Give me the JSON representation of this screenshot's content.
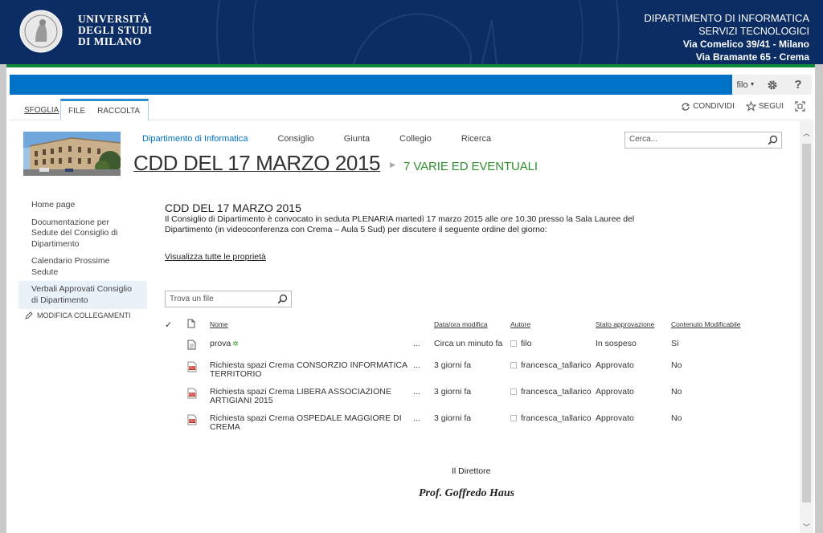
{
  "banner": {
    "university": [
      "UNIVERSITÀ",
      "DEGLI STUDI",
      "DI MILANO"
    ],
    "department": "DIPARTIMENTO DI INFORMATICA",
    "service": "SERVIZI TECNOLOGICI",
    "address_1": "Via Comelico 39/41 - Milano",
    "address_2": "Via Bramante 65 - Crema"
  },
  "suitebar": {
    "user": "filo",
    "icons": [
      "gear-icon",
      "help-icon"
    ],
    "help_label": "?"
  },
  "ribbon": {
    "tabs": [
      "SFOGLIA",
      "FILE",
      "RACCOLTA"
    ],
    "actions": [
      {
        "icon": "sync-icon",
        "label": "CONDIVIDI"
      },
      {
        "icon": "star-icon",
        "label": "SEGUI"
      },
      {
        "icon": "focus-icon",
        "label": ""
      }
    ]
  },
  "topnav": {
    "items": [
      "Dipartimento di Informatica",
      "Consiglio",
      "Giunta",
      "Collegio",
      "Ricerca"
    ],
    "selected": 0
  },
  "search": {
    "placeholder": "Cerca..."
  },
  "header": {
    "title": "CDD DEL 17 MARZO 2015",
    "subtitle": "7 VARIE ED EVENTUALI"
  },
  "quicklaunch": {
    "items": [
      "Home page",
      "Documentazione per Sedute del Consiglio di Dipartimento",
      "Calendario Prossime Sedute",
      "Verbali Approvati Consiglio di Dipartimento"
    ],
    "selected": 3,
    "edit_links": "MODIFICA COLLEGAMENTI"
  },
  "content": {
    "title": "CDD DEL 17 MARZO 2015",
    "description": "Il Consiglio di Dipartimento è convocato in seduta PLENARIA martedì 17 marzo 2015 alle ore 10.30 presso la Sala Lauree del Dipartimento (in videoconferenza con Crema – Aula 5 Sud) per discutere il seguente ordine del giorno:",
    "properties_link": "Visualizza tutte le proprietà",
    "find_placeholder": "Trova un file"
  },
  "table": {
    "columns": [
      "Nome",
      "Data/ora modifica",
      "Autore",
      "Stato approvazione",
      "Contenuto Modificabile"
    ],
    "rows": [
      {
        "icon": "document-icon",
        "name": "prova",
        "is_new": true,
        "modified": "Circa un minuto fa",
        "author": "filo",
        "status": "In sospeso",
        "editable": "Sì"
      },
      {
        "icon": "pdf-icon",
        "name": "Richiesta spazi Crema CONSORZIO INFORMATICA TERRITORIO",
        "is_new": false,
        "modified": "3 giorni fa",
        "author": "francesca_tallarico",
        "status": "Approvato",
        "editable": "No"
      },
      {
        "icon": "pdf-icon",
        "name": "Richiesta spazi Crema LIBERA ASSOCIAZIONE ARTIGIANI 2015",
        "is_new": false,
        "modified": "3 giorni fa",
        "author": "francesca_tallarico",
        "status": "Approvato",
        "editable": "No"
      },
      {
        "icon": "pdf-icon",
        "name": "Richiesta spazi Crema OSPEDALE MAGGIORE DI CREMA",
        "is_new": false,
        "modified": "3 giorni fa",
        "author": "francesca_tallarico",
        "status": "Approvato",
        "editable": "No"
      }
    ],
    "more_label": "...",
    "new_mark": "✲"
  },
  "footer": {
    "director_label": "Il Direttore",
    "director_name": "Prof.  Goffredo Haus"
  },
  "colors": {
    "banner": "#0b2d63",
    "accent_green": "#0f8a38",
    "suitebar": "#0072c6",
    "subtitle_green": "#2f8f2f"
  }
}
